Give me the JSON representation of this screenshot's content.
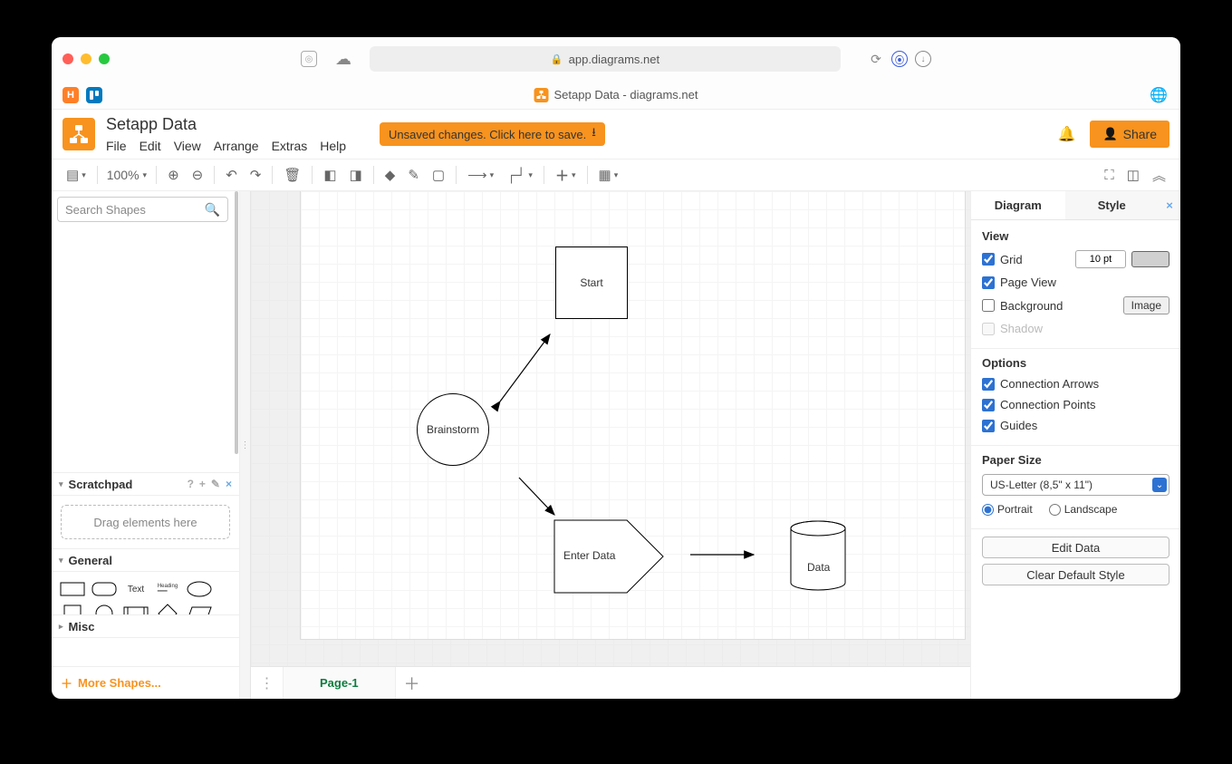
{
  "browser": {
    "url": "app.diagrams.net",
    "tab_title": "Setapp Data - diagrams.net"
  },
  "app": {
    "title": "Setapp Data",
    "menus": [
      "File",
      "Edit",
      "View",
      "Arrange",
      "Extras",
      "Help"
    ],
    "unsaved_msg": "Unsaved changes. Click here to save.",
    "share": "Share",
    "zoom": "100%"
  },
  "left": {
    "search_placeholder": "Search Shapes",
    "scratchpad": "Scratchpad",
    "drag_hint": "Drag elements here",
    "general": "General",
    "misc": "Misc",
    "more": "More Shapes..."
  },
  "canvas": {
    "page": "Page-1",
    "nodes": {
      "start": "Start",
      "brainstorm": "Brainstorm",
      "enter": "Enter Data",
      "data": "Data"
    }
  },
  "right": {
    "tab_diagram": "Diagram",
    "tab_style": "Style",
    "view": "View",
    "grid": "Grid",
    "grid_value": "10 pt",
    "pageview": "Page View",
    "background": "Background",
    "image": "Image",
    "shadow": "Shadow",
    "options": "Options",
    "conn_arrows": "Connection Arrows",
    "conn_points": "Connection Points",
    "guides": "Guides",
    "papersize": "Paper Size",
    "paper_value": "US-Letter (8,5\" x 11\")",
    "portrait": "Portrait",
    "landscape": "Landscape",
    "edit_data": "Edit Data",
    "clear_style": "Clear Default Style"
  }
}
